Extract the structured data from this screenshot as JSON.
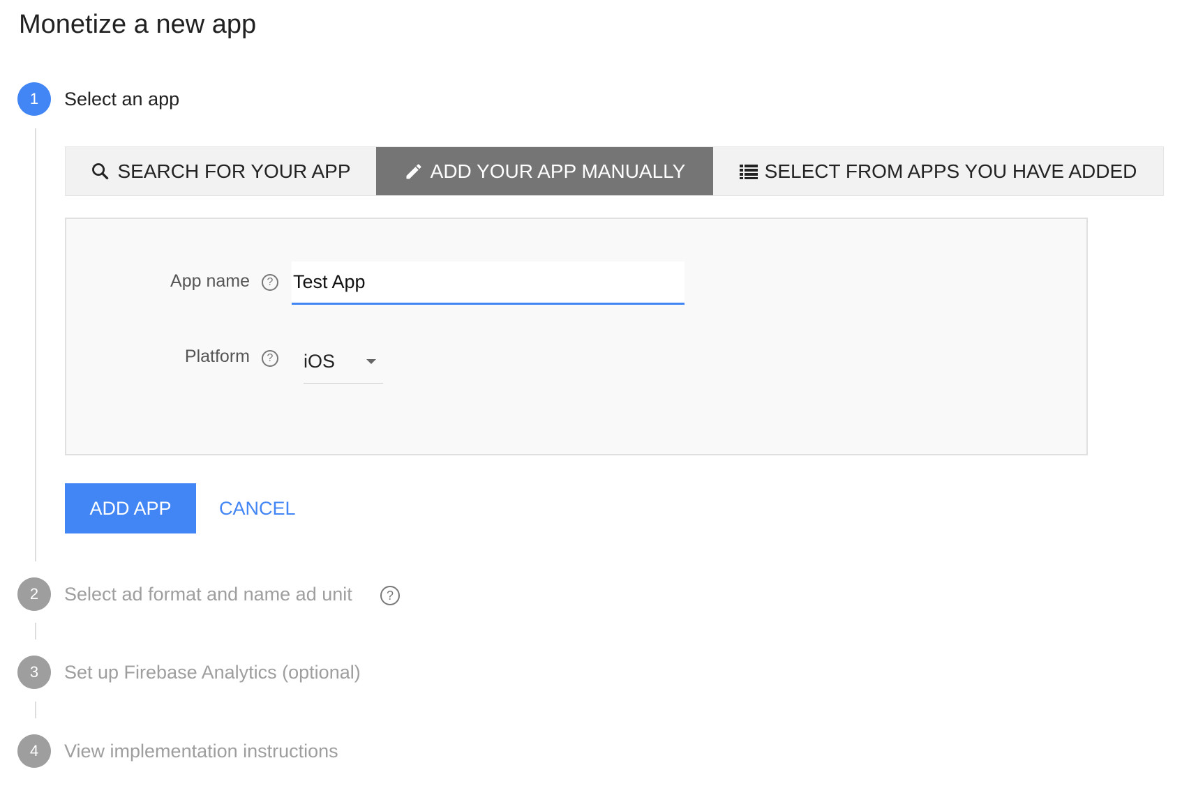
{
  "page": {
    "title": "Monetize a new app"
  },
  "steps": [
    {
      "number": "1",
      "label": "Select an app",
      "active": true
    },
    {
      "number": "2",
      "label": "Select ad format and name ad unit",
      "active": false
    },
    {
      "number": "3",
      "label": "Set up Firebase Analytics (optional)",
      "active": false
    },
    {
      "number": "4",
      "label": "View implementation instructions",
      "active": false
    }
  ],
  "tabs": [
    {
      "label": "SEARCH FOR YOUR APP",
      "icon": "search-icon"
    },
    {
      "label": "ADD YOUR APP MANUALLY",
      "icon": "pencil-icon",
      "active": true
    },
    {
      "label": "SELECT FROM APPS YOU HAVE ADDED",
      "icon": "list-icon"
    }
  ],
  "form": {
    "app_name_label": "App name",
    "app_name_value": "Test App",
    "platform_label": "Platform",
    "platform_value": "iOS",
    "help_glyph": "?"
  },
  "actions": {
    "add_app": "ADD APP",
    "cancel": "CANCEL"
  },
  "colors": {
    "accent": "#4285f4",
    "active_tab": "#757575",
    "inactive_step": "#9e9e9e"
  }
}
